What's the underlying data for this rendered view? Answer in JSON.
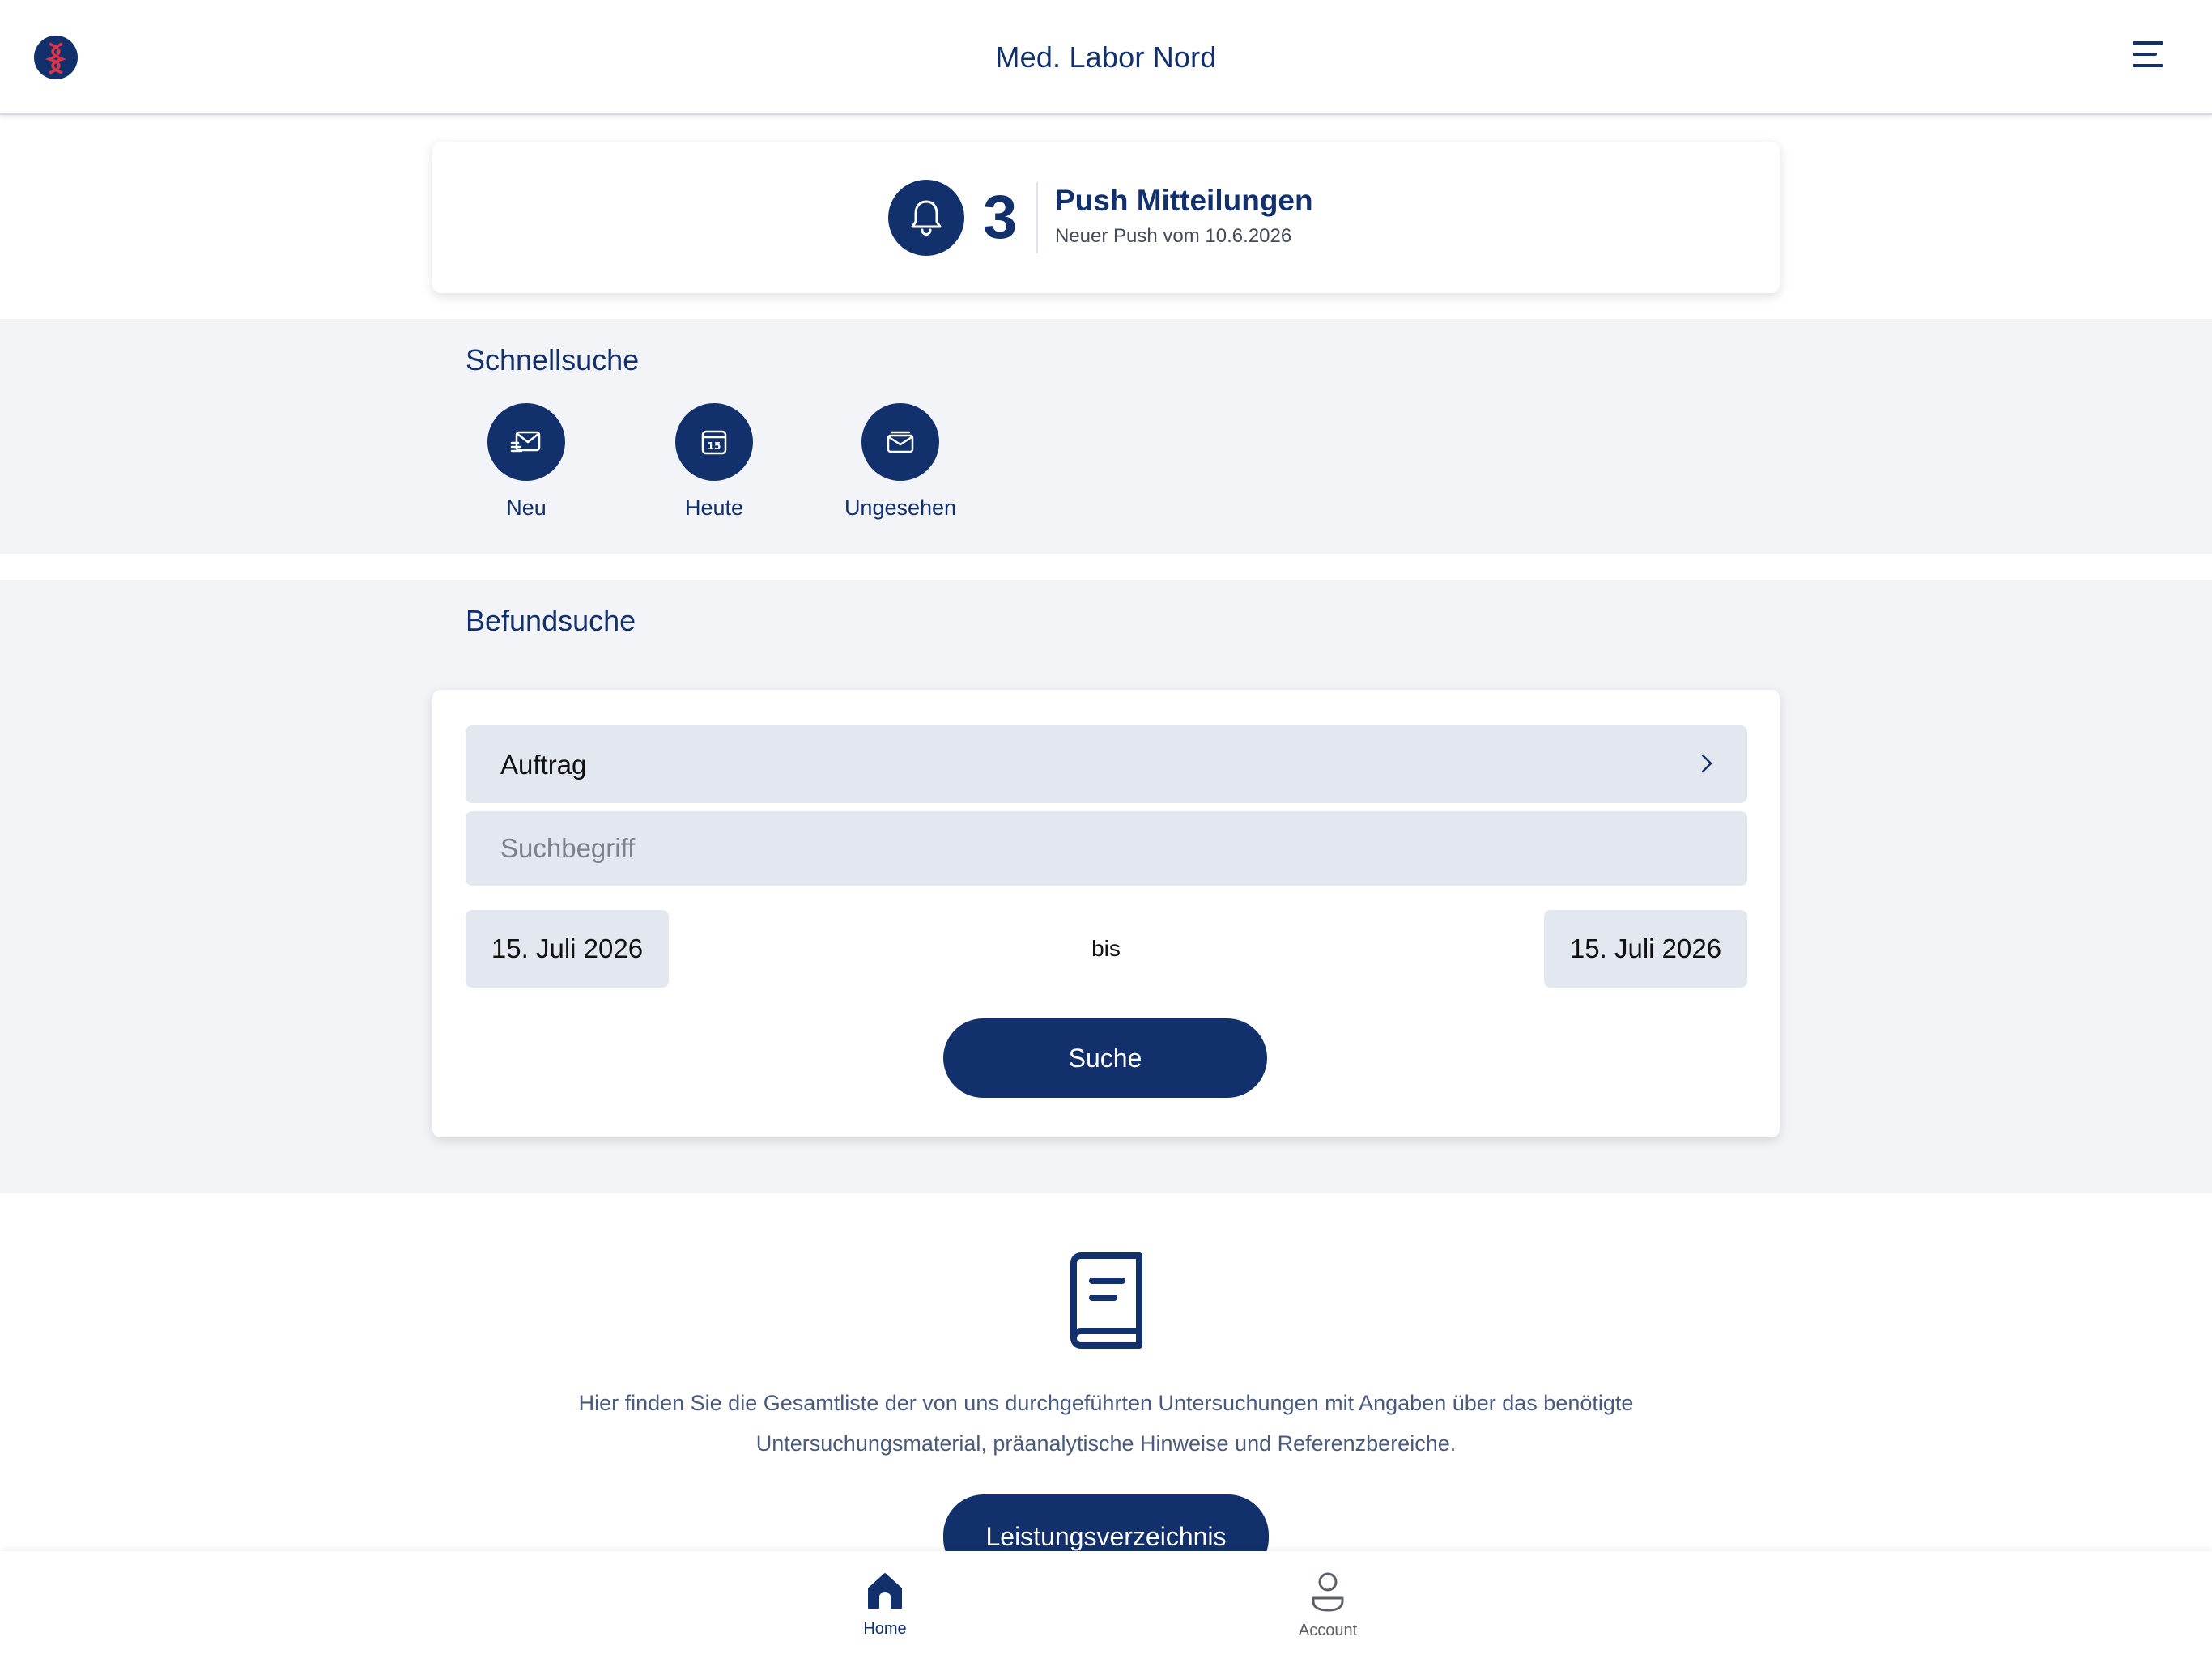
{
  "header": {
    "title": "Med. Labor Nord",
    "logo_icon": "dna-logo-icon",
    "menu_icon": "hamburger-menu-icon"
  },
  "push": {
    "count": "3",
    "title": "Push Mitteilungen",
    "subtitle": "Neuer Push vom 10.6.2026",
    "icon": "bell-icon"
  },
  "quick_search": {
    "title": "Schnellsuche",
    "items": [
      {
        "label": "Neu",
        "icon": "new-mail-icon"
      },
      {
        "label": "Heute",
        "icon": "calendar-icon"
      },
      {
        "label": "Ungesehen",
        "icon": "unread-mail-icon"
      }
    ]
  },
  "result_search": {
    "title": "Befundsuche",
    "select_label": "Auftrag",
    "search_placeholder": "Suchbegriff",
    "search_value": "",
    "date_from": "15. Juli 2026",
    "date_separator": "bis",
    "date_to": "15. Juli 2026",
    "submit_label": "Suche"
  },
  "catalog": {
    "icon": "book-icon",
    "text_line1": "Hier finden Sie die Gesamtliste der von uns durchgeführten Untersuchungen mit Angaben über das benötigte",
    "text_line2": "Untersuchungsmaterial, präanalytische Hinweise und Referenzbereiche.",
    "button_label": "Leistungsverzeichnis"
  },
  "tabbar": {
    "tabs": [
      {
        "label": "Home",
        "icon": "home-icon",
        "active": true
      },
      {
        "label": "Account",
        "icon": "user-icon",
        "active": false
      }
    ]
  },
  "colors": {
    "primary": "#12306b",
    "accent_red": "#d8344a",
    "section_bg": "#f2f4f8",
    "input_bg": "#e3e7f0",
    "inactive_tab": "#5b5f68"
  }
}
